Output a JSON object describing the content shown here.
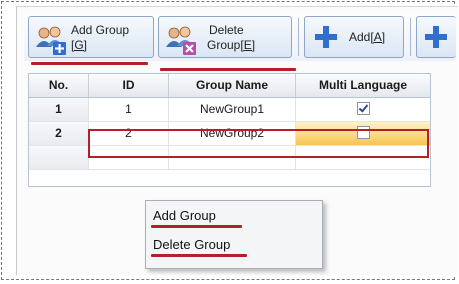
{
  "toolbar": {
    "add_group_label_1": "Add Group",
    "add_group_hotkey": "[G]",
    "delete_group_label_1": "Delete",
    "delete_group_label_2": "Group",
    "delete_group_hotkey": "[E]",
    "add_label": "Add",
    "add_hotkey": "[A]"
  },
  "grid": {
    "columns": [
      "No.",
      "ID",
      "Group Name",
      "Multi Language"
    ],
    "rows": [
      {
        "no": "1",
        "id": "1",
        "name": "NewGroup1",
        "multi_language": true
      },
      {
        "no": "2",
        "id": "2",
        "name": "NewGroup2",
        "multi_language": false
      }
    ]
  },
  "context_menu": {
    "items": [
      "Add Group",
      "Delete Group"
    ]
  },
  "colors": {
    "annotation_red": "#b3202a",
    "selection_orange": "#f7c54e",
    "icon_blue": "#2f6fd1"
  }
}
